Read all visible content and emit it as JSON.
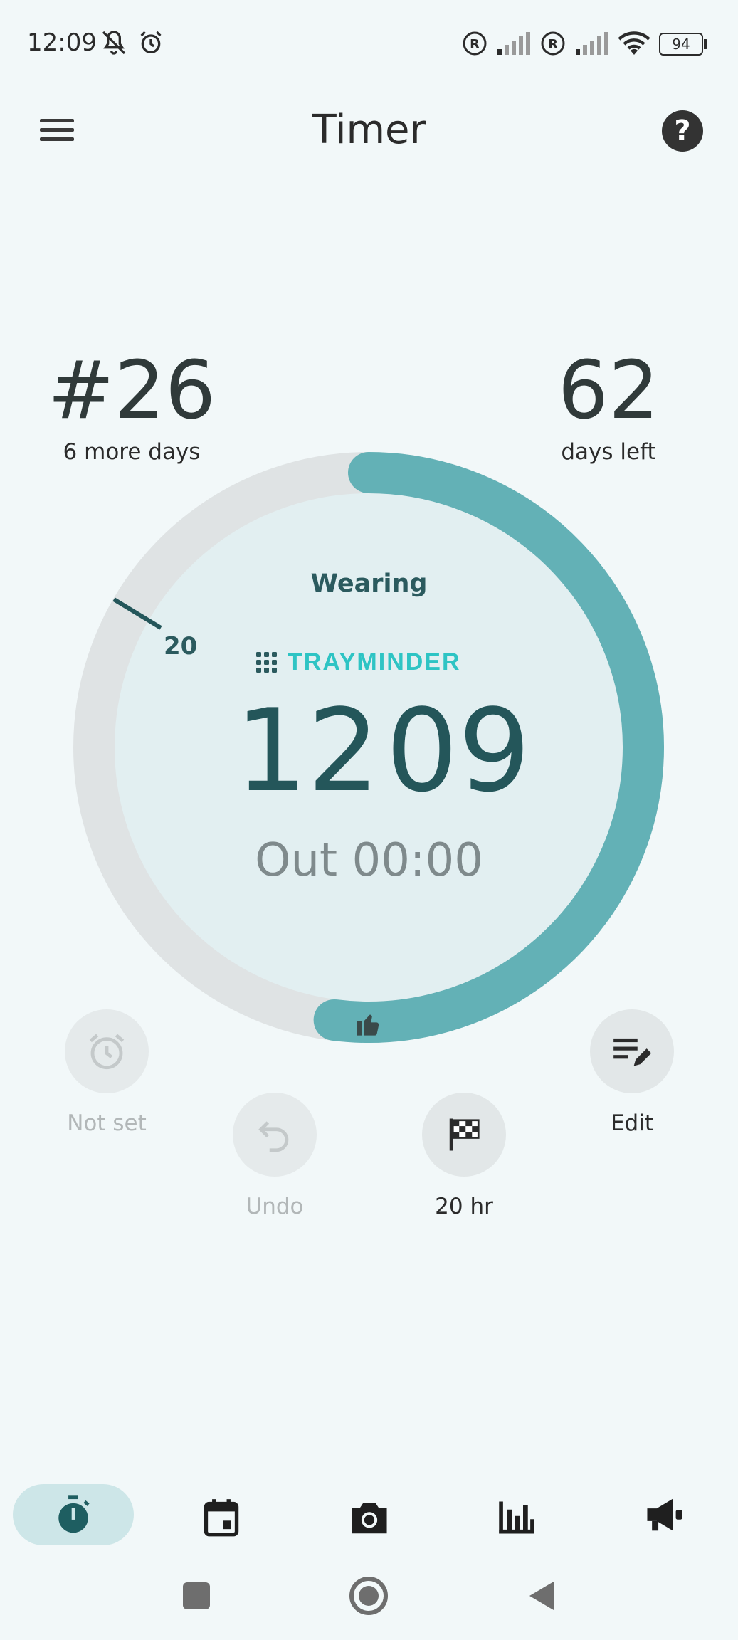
{
  "status_bar": {
    "time": "12:09",
    "battery": "94"
  },
  "header": {
    "title": "Timer"
  },
  "stats": {
    "streak_number": "#26",
    "streak_sub": "6 more days",
    "days_left_number": "62",
    "days_left_sub": "days left"
  },
  "ring": {
    "progress_fraction": 0.52,
    "tick_label": "20",
    "status": "Wearing",
    "brand": "TRAYMINDER",
    "time_hours": "12",
    "time_minutes": "09",
    "out_text": "Out 00:00"
  },
  "actions": {
    "alarm_label": "Not set",
    "undo_label": "Undo",
    "goal_label": "20 hr",
    "edit_label": "Edit"
  },
  "bottom_nav": {
    "items": [
      "timer-icon",
      "calendar-icon",
      "camera-icon",
      "bar-chart-icon",
      "megaphone-icon"
    ]
  },
  "colors": {
    "accent": "#63b1b6",
    "track": "#dfe3e4",
    "inner": "#e2eff1",
    "text_dark": "#24565a"
  }
}
